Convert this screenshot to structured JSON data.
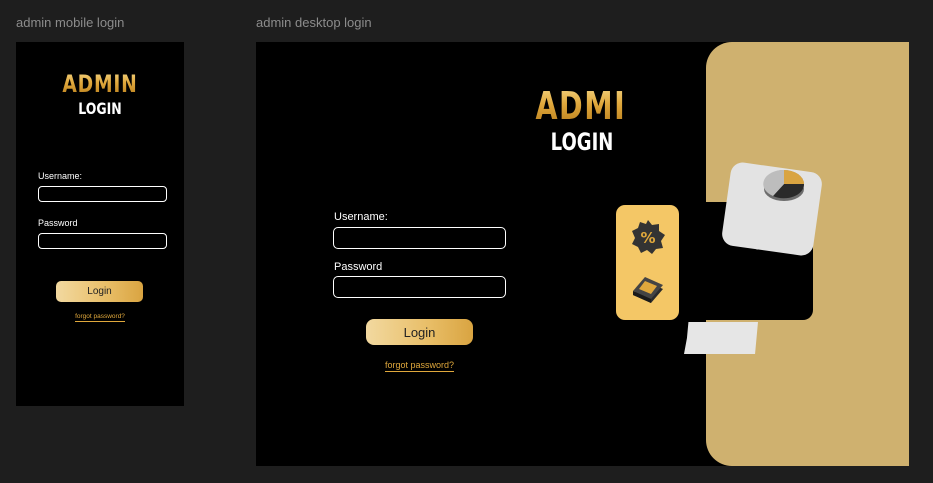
{
  "frames": {
    "mobile_label": "admin mobile login",
    "desktop_label": "admin desktop login"
  },
  "mobile": {
    "title": "ADMIN",
    "subtitle": "LOGIN",
    "username_label": "Username:",
    "password_label": "Password",
    "login_button": "Login",
    "forgot_link": "forgot password?"
  },
  "desktop": {
    "title": "ADMIN",
    "subtitle": "LOGIN",
    "username_label": "Username:",
    "password_label": "Password",
    "login_button": "Login",
    "forgot_link": "forgot password?",
    "illustration_icons": [
      "pie-chart-icon",
      "percent-badge-icon",
      "money-stack-icon"
    ]
  },
  "colors": {
    "gold_accent": "#e0a83c",
    "gold_panel": "#cfb16f",
    "icon_card": "#f4c766",
    "background": "#000000",
    "canvas": "#1e1e1e"
  }
}
